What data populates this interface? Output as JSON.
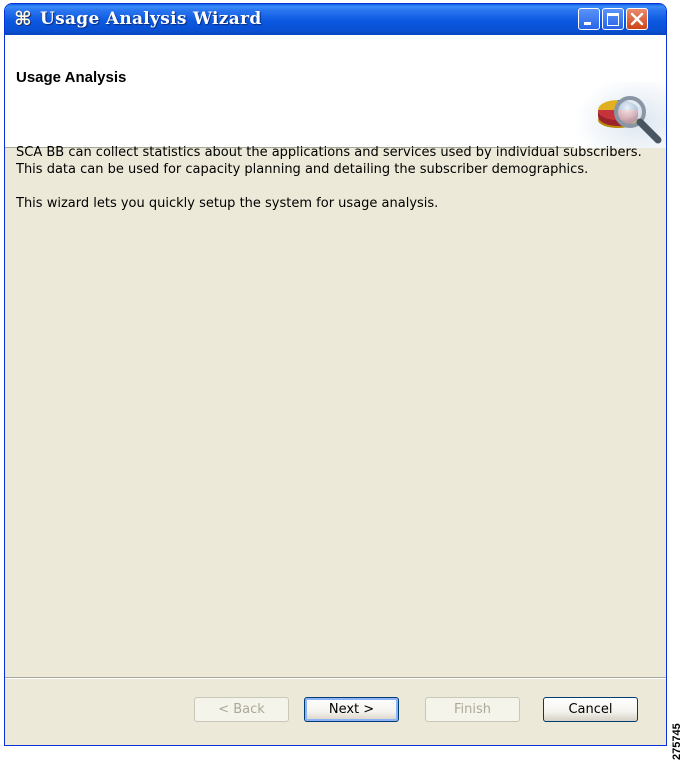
{
  "window": {
    "title": "Usage Analysis Wizard",
    "app_icon": "command-icon",
    "controls": [
      "minimize-icon",
      "maximize-icon",
      "close-icon"
    ]
  },
  "header": {
    "title": "Usage Analysis",
    "graphic": "pie-chart-magnifier-icon"
  },
  "content": {
    "paragraphs": [
      "SCA BB can collect statistics about the applications and services used by individual subscribers. This data can be used for capacity planning and detailing the subscriber demographics.",
      "This wizard lets you quickly setup the system for usage analysis."
    ]
  },
  "buttons": {
    "back": "< Back",
    "next": "Next >",
    "finish": "Finish",
    "cancel": "Cancel"
  },
  "figure_id": "275745",
  "colors": {
    "titlebar": "#0a58e0",
    "dialog_bg": "#ece9d8",
    "header_bg": "#ffffff",
    "close_button": "#cf4419"
  }
}
